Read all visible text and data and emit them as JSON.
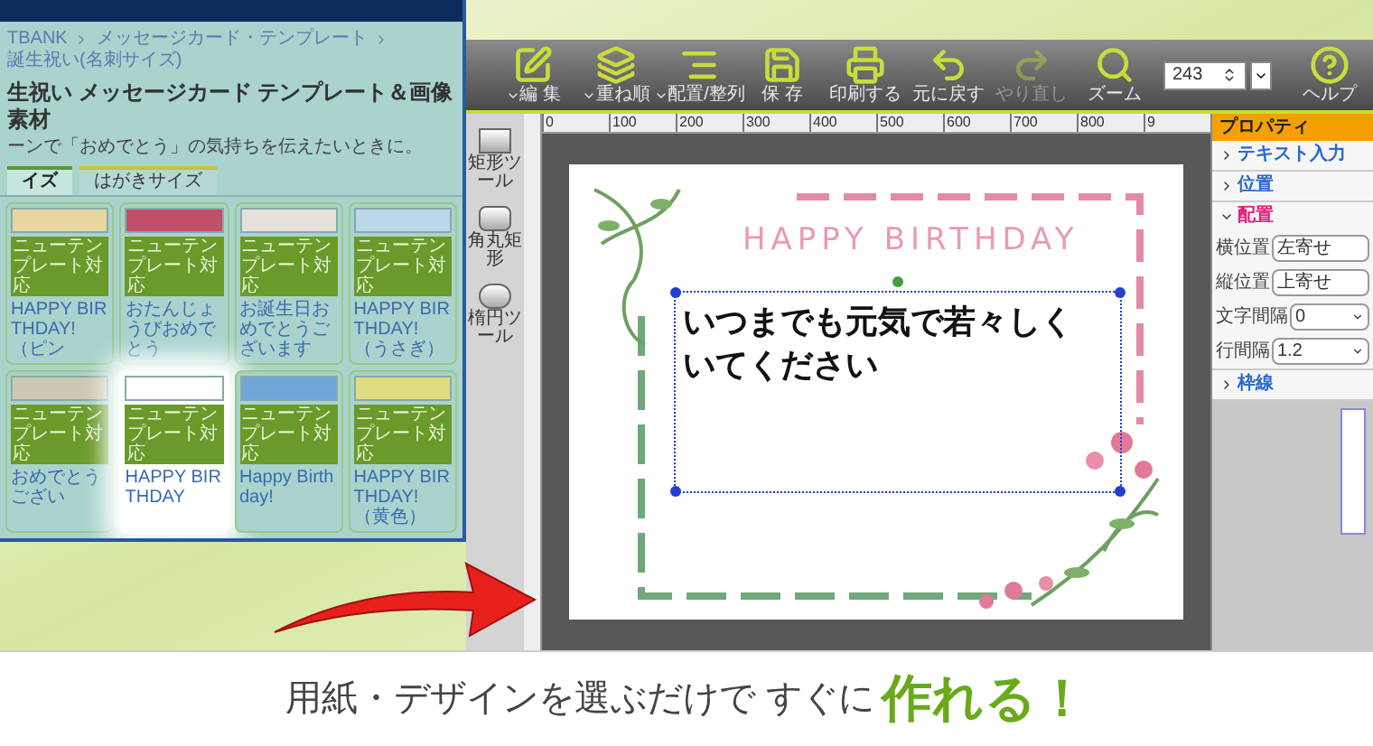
{
  "browser": {
    "breadcrumb": [
      "TBANK",
      "メッセージカード・テンプレート",
      "誕生祝い(名刺サイズ)"
    ],
    "title": "生祝い メッセージカード テンプレート＆画像素材",
    "subtitle": "ーンで「おめでとう」の気持ちを伝えたいときに。",
    "tabs": [
      {
        "label": "イズ",
        "selected": true
      },
      {
        "label": "はがきサイズ",
        "selected": false
      }
    ],
    "cards": [
      {
        "badge": "ニューテンプレート対応",
        "caption": "HAPPY BIRTHDAY!（ピン",
        "highlighted": false
      },
      {
        "badge": "ニューテンプレート対応",
        "caption": "おたんじょうびおめでとう",
        "highlighted": false
      },
      {
        "badge": "ニューテンプレート対応",
        "caption": "お誕生日おめでとうございます",
        "highlighted": false
      },
      {
        "badge": "ニューテンプレート対応",
        "caption": "HAPPY BIRTHDAY!（うさぎ）",
        "highlighted": false
      },
      {
        "badge": "ニューテンプレート対応",
        "caption": "おめでとうござい",
        "highlighted": false
      },
      {
        "badge": "ニューテンプレート対応",
        "caption": "HAPPY BIRTHDAY",
        "highlighted": true
      },
      {
        "badge": "ニューテンプレート対応",
        "caption": "Happy Birthday!",
        "highlighted": false
      },
      {
        "badge": "ニューテンプレート対応",
        "caption": "HAPPY BIRTHDAY!（黄色）",
        "highlighted": false
      }
    ]
  },
  "toolbar": {
    "items": [
      {
        "kind": "edit",
        "label": "編 集",
        "caret": true,
        "disabled": false
      },
      {
        "kind": "order",
        "label": "重ね順",
        "caret": true,
        "disabled": false
      },
      {
        "kind": "align",
        "label": "配置/整列",
        "caret": true,
        "disabled": false
      },
      {
        "kind": "save",
        "label": "保 存",
        "caret": false,
        "disabled": false
      },
      {
        "kind": "print",
        "label": "印刷する",
        "caret": false,
        "disabled": false
      },
      {
        "kind": "undo",
        "label": "元に戻す",
        "caret": false,
        "disabled": false
      },
      {
        "kind": "redo",
        "label": "やり直し",
        "caret": false,
        "disabled": true
      },
      {
        "kind": "zoom",
        "label": "ズーム",
        "caret": false,
        "disabled": false
      }
    ],
    "zoom_field": {
      "value": "243"
    },
    "help": {
      "label": "ヘルプ"
    }
  },
  "ruler": [
    "0",
    "100",
    "200",
    "300",
    "400",
    "500",
    "600",
    "700",
    "800",
    "9"
  ],
  "tools": [
    {
      "kind": "rect",
      "label": "矩形ツール"
    },
    {
      "kind": "rounded",
      "label": "角丸矩形"
    },
    {
      "kind": "ellipse",
      "label": "楕円ツール"
    }
  ],
  "card": {
    "title": "HAPPY BIRTHDAY",
    "message": [
      "いつまでも元気で若々しく",
      "いてください"
    ]
  },
  "properties": {
    "title": "プロパティ",
    "sections": [
      {
        "label": "テキスト入力",
        "expanded": false
      },
      {
        "label": "位置",
        "expanded": false
      },
      {
        "label": "配置",
        "expanded": true,
        "fields": [
          {
            "label": "横位置",
            "value": "左寄せ",
            "kind": "text"
          },
          {
            "label": "縦位置",
            "value": "上寄せ",
            "kind": "text"
          },
          {
            "label": "文字間隔",
            "value": "0",
            "kind": "select"
          },
          {
            "label": "行間隔",
            "value": "1.2",
            "kind": "select"
          }
        ]
      },
      {
        "label": "枠線",
        "expanded": false
      }
    ]
  },
  "caption": {
    "lead": "用紙・デザインを選ぶだけで すぐに",
    "emphasis": "作れる！"
  }
}
